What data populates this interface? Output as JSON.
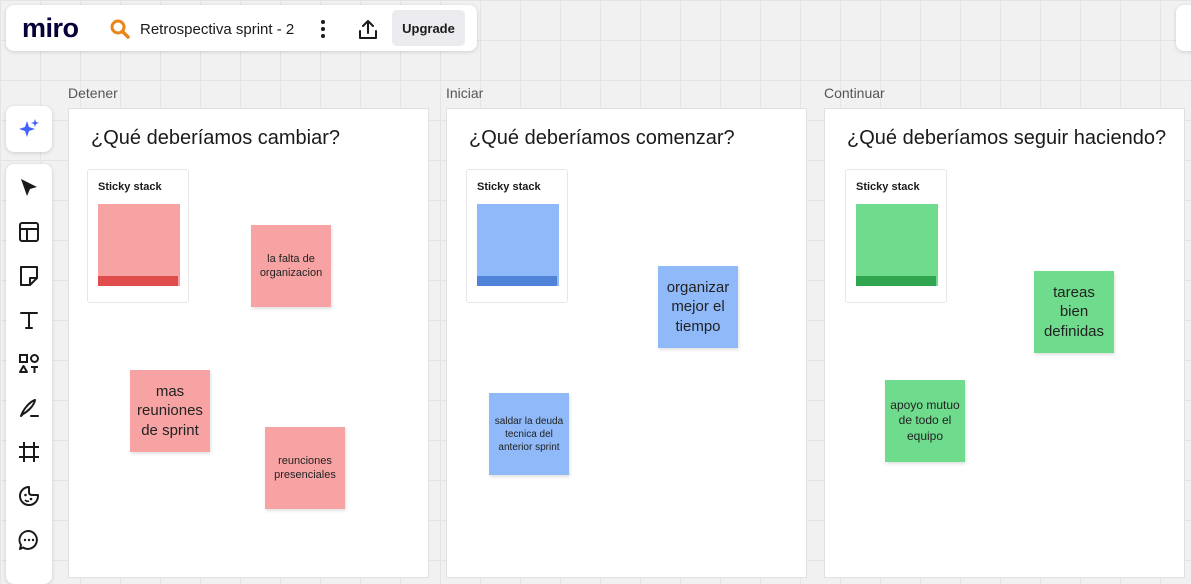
{
  "topbar": {
    "logo": "miro",
    "board_title": "Retrospectiva sprint - 2",
    "upgrade_label": "Upgrade",
    "board_icon": "magnifier-icon",
    "menu_icon": "kebab-menu-icon",
    "share_icon": "share-upload-icon"
  },
  "toolbar": {
    "ai_icon": "sparkle-ai-icon",
    "tools": [
      "select-cursor-icon",
      "templates-icon",
      "sticky-note-icon",
      "text-icon",
      "shapes-icon",
      "pen-icon",
      "frame-icon",
      "sticker-emoji-icon",
      "comment-icon"
    ]
  },
  "frames": [
    {
      "label": "Detener",
      "title": "¿Qué deberíamos cambiar?",
      "stack_label": "Sticky stack",
      "color": "#f7a3a3",
      "stickies": [
        "la falta de organizacion",
        "mas reuniones de sprint",
        "reunciones presenciales"
      ]
    },
    {
      "label": "Iniciar",
      "title": "¿Qué deberíamos comenzar?",
      "stack_label": "Sticky stack",
      "color": "#8fb9f9",
      "stickies": [
        "organizar mejor el tiempo",
        "saldar la deuda tecnica del anterior sprint"
      ]
    },
    {
      "label": "Continuar",
      "title": "¿Qué deberíamos seguir haciendo?",
      "stack_label": "Sticky stack",
      "color": "#6fdb8c",
      "stickies": [
        "tareas bien definidas",
        "apoyo mutuo de todo el equipo"
      ]
    }
  ]
}
